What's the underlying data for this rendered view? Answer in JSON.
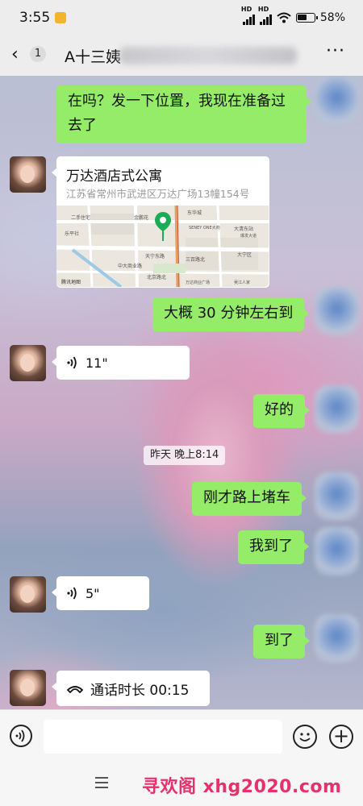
{
  "status_bar": {
    "time": "3:55",
    "net1": "HD",
    "net2": "HD",
    "battery_pct": "58%",
    "battery_level": 0.58
  },
  "nav": {
    "back_count": "1",
    "title": "A十三姨",
    "more": "···"
  },
  "messages": [
    {
      "side": "right",
      "text_line1": "在吗？发一下位置，我现在准备过",
      "text_line2": "去了"
    },
    {
      "side": "left",
      "type": "location",
      "title": "万达酒店式公寓",
      "address": "江苏省常州市武进区万达广场13幢154号",
      "map_labels": [
        "二手住宅",
        "金鹏花",
        "东华城",
        "SENEY ONE大商",
        "大清东站",
        "爆发大道",
        "乐平社",
        "天宁东路",
        "中大商业路",
        "大宁区",
        "三百路北",
        "北京路北",
        "腾讯地图",
        "万达商业广场",
        "吴江人家"
      ]
    },
    {
      "side": "right",
      "text": "大概 30 分钟左右到"
    },
    {
      "side": "left",
      "type": "voice",
      "duration": "11\""
    },
    {
      "side": "right",
      "text": "好的"
    },
    {
      "side": "center",
      "type": "time",
      "text": "昨天 晚上8:14"
    },
    {
      "side": "right",
      "text": "刚才路上堵车"
    },
    {
      "side": "right",
      "text": "我到了"
    },
    {
      "side": "left",
      "type": "voice",
      "duration": "5\""
    },
    {
      "side": "right",
      "text": "到了"
    },
    {
      "side": "left",
      "type": "call",
      "text": "通话时长 00:15"
    }
  ],
  "watermark": "寻欢阁 xhg2020.com",
  "colors": {
    "bubble_sent": "#95ec69",
    "bubble_received": "#ffffff",
    "bar_bg": "#ededed",
    "watermark": "#e8306b"
  },
  "icons": [
    "back-arrow-icon",
    "more-icon",
    "voice-icon",
    "phone-icon",
    "voice-input-icon",
    "emoji-icon",
    "plus-icon",
    "menu-icon",
    "map-pin-icon"
  ]
}
